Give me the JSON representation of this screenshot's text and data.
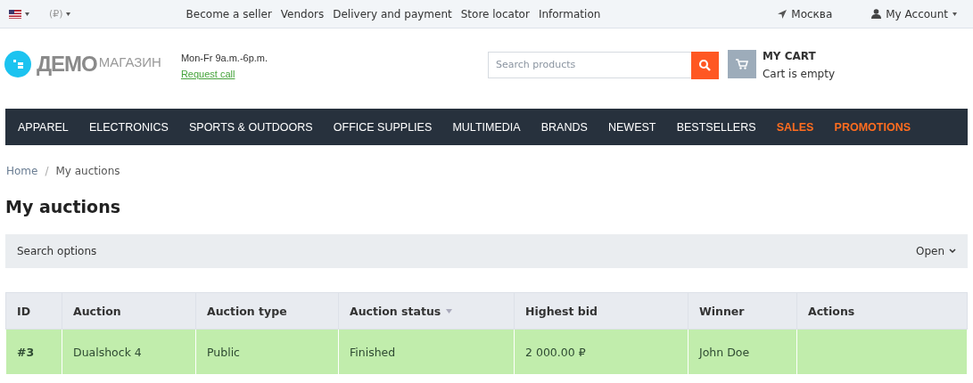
{
  "top_bar": {
    "currency": "(₽)",
    "links": [
      "Become a seller",
      "Vendors",
      "Delivery and payment",
      "Store locator",
      "Information"
    ],
    "city": "Москва",
    "account": "My Account"
  },
  "header": {
    "logo_main": "ДЕМО",
    "logo_sub": "МАГАЗИН",
    "hours": "Mon-Fr 9a.m.-6p.m.",
    "request_call": "Request call",
    "search": {
      "placeholder": "Search products"
    },
    "cart": {
      "title": "MY CART",
      "status": "Cart is empty"
    }
  },
  "nav": [
    {
      "label": "APPAREL",
      "kind": "normal"
    },
    {
      "label": "ELECTRONICS",
      "kind": "normal"
    },
    {
      "label": "SPORTS & OUTDOORS",
      "kind": "normal"
    },
    {
      "label": "OFFICE SUPPLIES",
      "kind": "normal"
    },
    {
      "label": "MULTIMEDIA",
      "kind": "normal"
    },
    {
      "label": "BRANDS",
      "kind": "normal"
    },
    {
      "label": "NEWEST",
      "kind": "normal"
    },
    {
      "label": "BESTSELLERS",
      "kind": "normal"
    },
    {
      "label": "SALES",
      "kind": "promo"
    },
    {
      "label": "PROMOTIONS",
      "kind": "promo"
    }
  ],
  "breadcrumbs": {
    "items": [
      "Home",
      "My auctions"
    ],
    "separator": "/"
  },
  "page_title": "My auctions",
  "search_options": {
    "label": "Search options",
    "toggle": "Open",
    "expanded": false
  },
  "table": {
    "columns": [
      {
        "label": "ID",
        "sorted": false
      },
      {
        "label": "Auction",
        "sorted": false
      },
      {
        "label": "Auction type",
        "sorted": false
      },
      {
        "label": "Auction status",
        "sorted": true
      },
      {
        "label": "Highest bid",
        "sorted": false
      },
      {
        "label": "Winner",
        "sorted": false
      },
      {
        "label": "Actions",
        "sorted": false
      }
    ],
    "rows": [
      {
        "highlighted": true,
        "id": "#3",
        "auction": "Dualshock 4",
        "type": "Public",
        "status": "Finished",
        "bid": "2 000.00 ₽",
        "winner": "John Doe"
      }
    ]
  }
}
